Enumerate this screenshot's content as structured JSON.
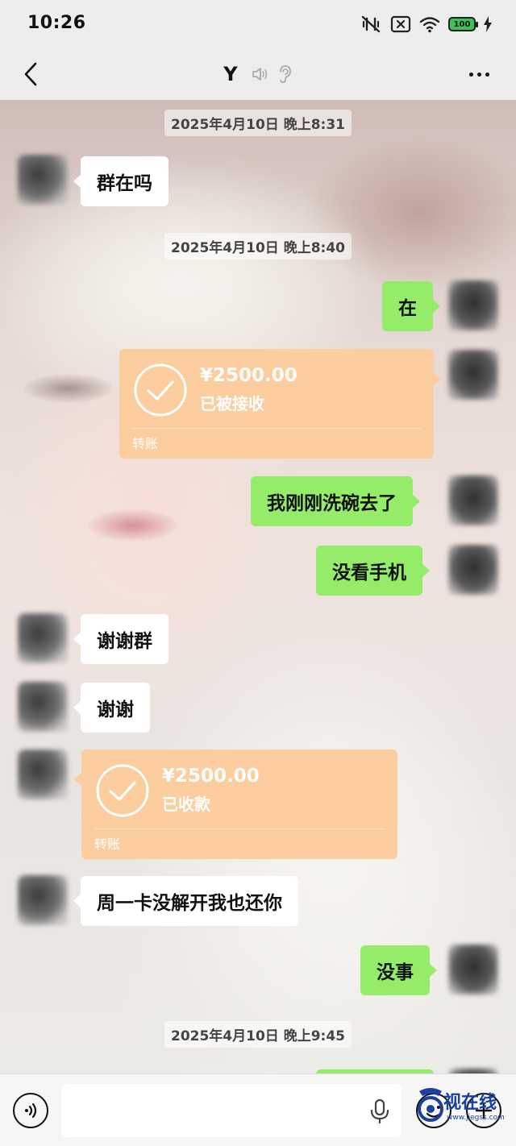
{
  "status_bar": {
    "time": "10:26",
    "battery": "100",
    "icons": [
      "mute-vibrate-icon",
      "sim-off-icon",
      "wifi-icon",
      "battery-icon",
      "charging-icon"
    ]
  },
  "nav": {
    "title": "Y",
    "icons": [
      "back-icon",
      "voice-off-icon",
      "ear-icon",
      "more-icon"
    ]
  },
  "chat": {
    "timestamps": [
      "2025年4月10日 晚上8:31",
      "2025年4月10日 晚上8:40",
      "2025年4月10日 晚上9:45"
    ],
    "messages": [
      {
        "side": "left",
        "type": "text",
        "text": "群在吗"
      },
      {
        "side": "right",
        "type": "text",
        "text": "在"
      },
      {
        "side": "right",
        "type": "transfer",
        "amount": "¥2500.00",
        "status": "已被接收",
        "label": "转账"
      },
      {
        "side": "right",
        "type": "text",
        "text": "我刚刚洗碗去了"
      },
      {
        "side": "right",
        "type": "text",
        "text": "没看手机"
      },
      {
        "side": "left",
        "type": "text",
        "text": "谢谢群"
      },
      {
        "side": "left",
        "type": "text",
        "text": "谢谢"
      },
      {
        "side": "left",
        "type": "transfer",
        "amount": "¥2500.00",
        "status": "已收款",
        "label": "转账"
      },
      {
        "side": "left",
        "type": "text",
        "text": "周一卡没解开我也还你"
      },
      {
        "side": "right",
        "type": "text",
        "text": "没事"
      }
    ]
  },
  "colors": {
    "sent_bubble": "#95ec69",
    "received_bubble": "#ffffff",
    "transfer_bubble": "#fbcd9f",
    "bar_background": "#ededed"
  },
  "watermark": {
    "text": "视在线",
    "sub": "www.jiegss.com"
  }
}
